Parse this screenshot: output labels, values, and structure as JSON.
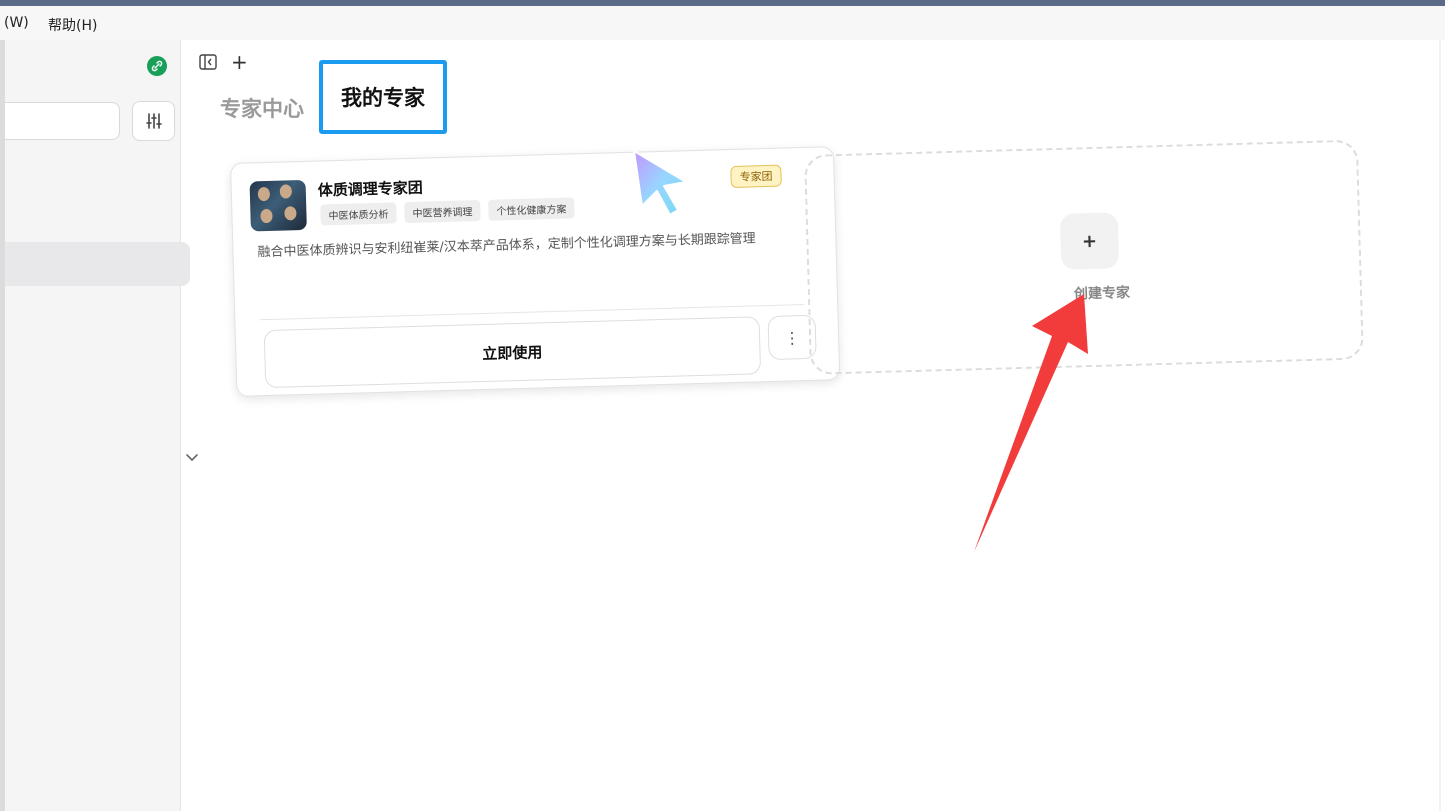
{
  "menubar": {
    "items": [
      "(W)",
      "帮助(H)"
    ]
  },
  "sidebar": {
    "sync_icon": "link-icon",
    "filter_icon": "sliders-icon",
    "expand_icon": "chevron-down-icon"
  },
  "toolbar": {
    "new_tab_label": "+"
  },
  "tabs": {
    "expert_center": "专家中心",
    "my_experts": "我的专家"
  },
  "expert_card": {
    "title": "体质调理专家团",
    "badge": "专家团",
    "tags": [
      "中医体质分析",
      "中医营养调理",
      "个性化健康方案"
    ],
    "description": "融合中医体质辨识与安利纽崔莱/汉本萃产品体系，定制个性化调理方案与长期跟踪管理",
    "use_button": "立即使用",
    "more_button": "⋮"
  },
  "create_card": {
    "plus": "+",
    "label": "创建专家"
  },
  "colors": {
    "tab_highlight": "#1a9bf0",
    "annotation_arrow": "#f23c3c",
    "sync_badge": "#18a058",
    "badge_bg": "#fff3c4"
  }
}
